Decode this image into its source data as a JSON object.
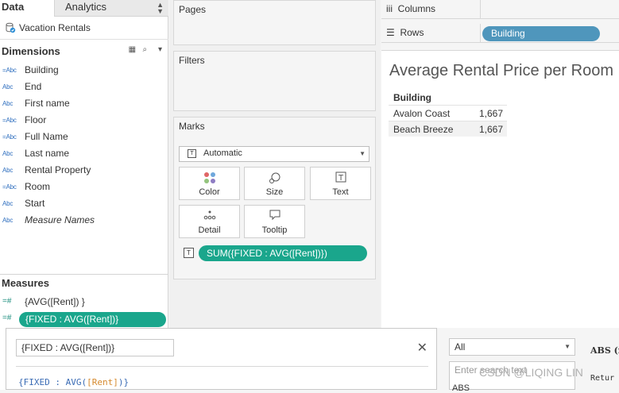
{
  "tabs": {
    "data": "Data",
    "analytics": "Analytics"
  },
  "datasource": {
    "name": "Vacation Rentals"
  },
  "dimensions": {
    "header": "Dimensions",
    "fields": [
      {
        "type": "=Abc",
        "name": "Building",
        "italic": false
      },
      {
        "type": "Abc",
        "name": "End",
        "italic": false
      },
      {
        "type": "Abc",
        "name": "First name",
        "italic": false
      },
      {
        "type": "=Abc",
        "name": "Floor",
        "italic": false
      },
      {
        "type": "=Abc",
        "name": "Full Name",
        "italic": false
      },
      {
        "type": "Abc",
        "name": "Last name",
        "italic": false
      },
      {
        "type": "Abc",
        "name": "Rental Property",
        "italic": false
      },
      {
        "type": "=Abc",
        "name": "Room",
        "italic": false
      },
      {
        "type": "Abc",
        "name": "Start",
        "italic": false
      },
      {
        "type": "Abc",
        "name": "Measure Names",
        "italic": true
      }
    ]
  },
  "measures": {
    "header": "Measures",
    "fields": [
      {
        "type": "=#",
        "name": "{AVG([Rent]) }"
      },
      {
        "type": "=#",
        "name": "{FIXED : AVG([Rent])}"
      }
    ]
  },
  "cards": {
    "pages": "Pages",
    "filters": "Filters",
    "marks": "Marks"
  },
  "marks": {
    "type": "Automatic",
    "buttons": [
      {
        "label": "Color",
        "icon": "color-icon"
      },
      {
        "label": "Size",
        "icon": "size-icon"
      },
      {
        "label": "Text",
        "icon": "text-icon"
      },
      {
        "label": "Detail",
        "icon": "detail-icon"
      },
      {
        "label": "Tooltip",
        "icon": "tooltip-icon"
      }
    ],
    "text_pill": "SUM({FIXED : AVG([Rent])})"
  },
  "shelves": {
    "columns": "Columns",
    "rows": "Rows",
    "rows_pill": "Building"
  },
  "view": {
    "title": "Average Rental Price per Room",
    "table_header": "Building",
    "rows": [
      {
        "name": "Avalon Coast",
        "value": "1,667"
      },
      {
        "name": "Beach Breeze",
        "value": "1,667"
      }
    ]
  },
  "calc_editor": {
    "name": "{FIXED : AVG([Rent])}",
    "formula_prefix": "{FIXED : AVG(",
    "formula_field": "[Rent]",
    "formula_suffix": ")}"
  },
  "functions": {
    "category": "All",
    "search_placeholder": "Enter search text",
    "first_item": "ABS",
    "doc_title": "ABS (n",
    "doc_text": "Retur"
  },
  "watermark": "CSDN @LIQING LIN"
}
